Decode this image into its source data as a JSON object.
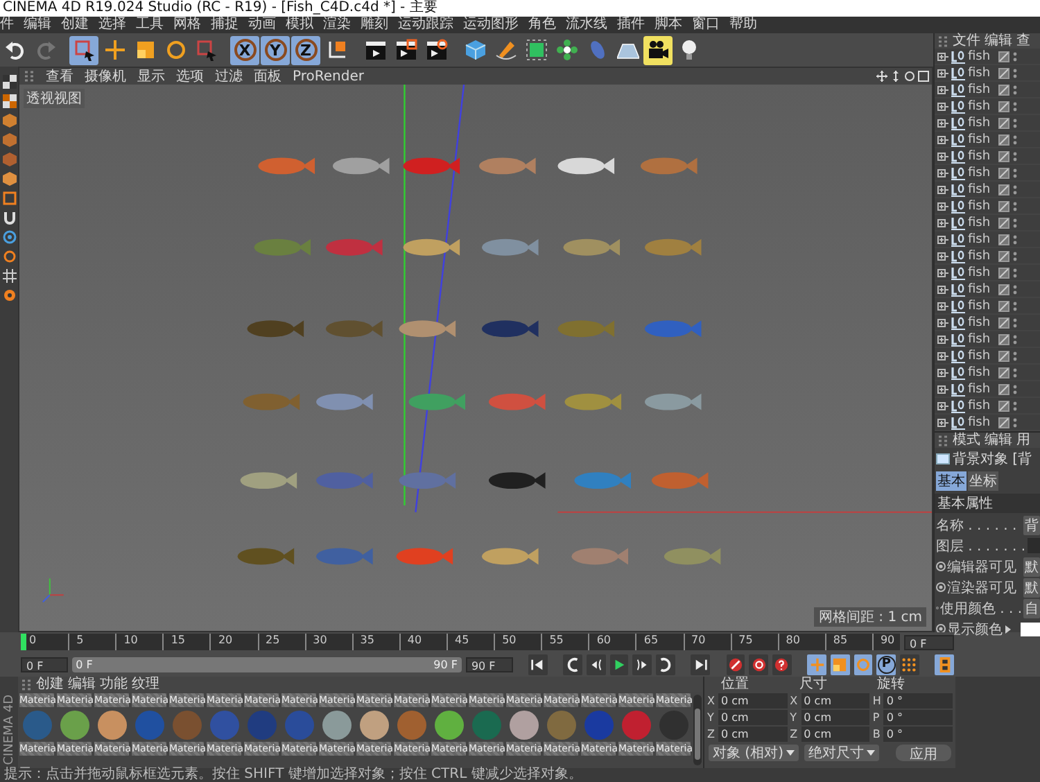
{
  "window": {
    "title": "CINEMA 4D R19.024 Studio (RC - R19) - [Fish_C4D.c4d *] - 主要"
  },
  "menu": [
    "件",
    "编辑",
    "创建",
    "选择",
    "工具",
    "网格",
    "捕捉",
    "动画",
    "模拟",
    "渲染",
    "雕刻",
    "运动跟踪",
    "运动图形",
    "角色",
    "流水线",
    "插件",
    "脚本",
    "窗口",
    "帮助"
  ],
  "toolbar": [
    {
      "kind": "undo",
      "selected": false,
      "disabled": false
    },
    {
      "kind": "redo",
      "selected": false,
      "disabled": true
    },
    {
      "kind": "select",
      "selected": true,
      "disabled": false
    },
    {
      "kind": "move",
      "selected": false,
      "disabled": false
    },
    {
      "kind": "scale",
      "selected": false,
      "disabled": false
    },
    {
      "kind": "rotate",
      "selected": false,
      "disabled": false
    },
    {
      "kind": "box_select",
      "selected": false,
      "disabled": false
    },
    {
      "kind": "axis",
      "label": "X",
      "selected": true,
      "disabled": false
    },
    {
      "kind": "axis",
      "label": "Y",
      "selected": true,
      "disabled": false
    },
    {
      "kind": "axis",
      "label": "Z",
      "selected": true,
      "disabled": false
    },
    {
      "kind": "coord",
      "selected": false,
      "disabled": false
    },
    {
      "kind": "render_view",
      "selected": false,
      "disabled": false
    },
    {
      "kind": "render_pic",
      "selected": false,
      "disabled": false
    },
    {
      "kind": "render_settings",
      "selected": false,
      "disabled": false
    },
    {
      "kind": "cube",
      "selected": false,
      "disabled": false
    },
    {
      "kind": "pen",
      "selected": false,
      "disabled": false
    },
    {
      "kind": "subdiv",
      "selected": false,
      "disabled": false
    },
    {
      "kind": "array",
      "selected": false,
      "disabled": false
    },
    {
      "kind": "deformer",
      "selected": false,
      "disabled": false
    },
    {
      "kind": "floor",
      "selected": false,
      "disabled": false
    },
    {
      "kind": "camera",
      "selected": false,
      "disabled": false
    },
    {
      "kind": "light",
      "selected": false,
      "disabled": false
    }
  ],
  "viewport": {
    "menu": [
      "查看",
      "摄像机",
      "显示",
      "选项",
      "过滤",
      "面板",
      "ProRender"
    ],
    "view_name": "透视视图",
    "grid_spacing": "网格间距 : 1 cm"
  },
  "object_manager": {
    "menu": [
      "文件",
      "编辑",
      "查"
    ],
    "objects": [
      {
        "name": "fish"
      },
      {
        "name": "fish"
      },
      {
        "name": "fish"
      },
      {
        "name": "fish"
      },
      {
        "name": "fish"
      },
      {
        "name": "fish"
      },
      {
        "name": "fish"
      },
      {
        "name": "fish"
      },
      {
        "name": "fish"
      },
      {
        "name": "fish"
      },
      {
        "name": "fish"
      },
      {
        "name": "fish"
      },
      {
        "name": "fish"
      },
      {
        "name": "fish"
      },
      {
        "name": "fish"
      },
      {
        "name": "fish"
      },
      {
        "name": "fish"
      },
      {
        "name": "fish"
      },
      {
        "name": "fish"
      },
      {
        "name": "fish"
      },
      {
        "name": "fish"
      },
      {
        "name": "fish"
      },
      {
        "name": "fish"
      }
    ]
  },
  "attributes": {
    "menu": [
      "模式",
      "编辑",
      "用"
    ],
    "object_title": "背景对象 [背",
    "tabs": [
      {
        "label": "基本",
        "selected": true
      },
      {
        "label": "坐标",
        "selected": false
      }
    ],
    "section": "基本属性",
    "rows": [
      {
        "kind": "field",
        "label": "名称 . . . . . .",
        "value": "背"
      },
      {
        "kind": "field",
        "label": "图层 . . . . . . ."
      },
      {
        "kind": "dropdown",
        "label": "编辑器可见",
        "value": "默"
      },
      {
        "kind": "dropdown",
        "label": "渲染器可见",
        "value": "默"
      },
      {
        "kind": "dropdown",
        "label": "使用颜色 . . .",
        "value": "自"
      },
      {
        "kind": "color",
        "label": "显示颜色",
        "color": "#ffffff"
      }
    ]
  },
  "timeline": {
    "ticks": [
      "0",
      "5",
      "10",
      "15",
      "20",
      "25",
      "30",
      "35",
      "40",
      "45",
      "50",
      "55",
      "60",
      "65",
      "70",
      "75",
      "80",
      "85",
      "90"
    ],
    "level": 0,
    "current_frame": "0 F",
    "start": "0 F",
    "range": {
      "start": "0 F",
      "end": "90 F",
      "level": 1
    },
    "end": "90 F",
    "parameter_key_label": "P"
  },
  "materials": {
    "menu": [
      "创建",
      "编辑",
      "功能",
      "纹理"
    ],
    "row_above": [
      "Materia",
      "Materia",
      "Materia",
      "Materia",
      "Materia",
      "Materia",
      "Materia",
      "Materia",
      "Materia",
      "Materia",
      "Materia",
      "Materia",
      "Materia",
      "Materia",
      "Materia",
      "Materia",
      "Materia",
      "Materia"
    ],
    "items": [
      {
        "label": "Materia",
        "color": "#2a5a8a"
      },
      {
        "label": "Materia",
        "color": "#6aa04a"
      },
      {
        "label": "Materia",
        "color": "#c89060"
      },
      {
        "label": "Materia",
        "color": "#2050a0"
      },
      {
        "label": "Materia",
        "color": "#7a5030"
      },
      {
        "label": "Materia",
        "color": "#3050a0"
      },
      {
        "label": "Materia",
        "color": "#203c80"
      },
      {
        "label": "Materia",
        "color": "#2a4c9a"
      },
      {
        "label": "Materia",
        "color": "#8a9a9a"
      },
      {
        "label": "Materia",
        "color": "#c0a080"
      },
      {
        "label": "Materia",
        "color": "#a06030"
      },
      {
        "label": "Materia",
        "color": "#60b040"
      },
      {
        "label": "Materia",
        "color": "#1a6a50"
      },
      {
        "label": "Materia",
        "color": "#b0a0a0"
      },
      {
        "label": "Materia",
        "color": "#806a40"
      },
      {
        "label": "Materia",
        "color": "#1a3aa0"
      },
      {
        "label": "Materia",
        "color": "#c02030"
      },
      {
        "label": "Materia",
        "color": "#303030"
      }
    ]
  },
  "coordinates": {
    "headers": [
      "位置",
      "尺寸",
      "旋转"
    ],
    "rows": [
      {
        "cells": [
          {
            "axis": "X",
            "value": "0 cm"
          },
          {
            "axis": "X",
            "value": "0 cm"
          },
          {
            "axis": "H",
            "value": "0 °"
          }
        ]
      },
      {
        "cells": [
          {
            "axis": "Y",
            "value": "0 cm"
          },
          {
            "axis": "Y",
            "value": "0 cm"
          },
          {
            "axis": "P",
            "value": "0 °"
          }
        ]
      },
      {
        "cells": [
          {
            "axis": "Z",
            "value": "0 cm"
          },
          {
            "axis": "Z",
            "value": "0 cm"
          },
          {
            "axis": "B",
            "value": "0 °"
          }
        ]
      }
    ],
    "dropdowns": [
      "对象 (相对)",
      "绝对尺寸"
    ],
    "apply_button": "应用"
  },
  "logo": "CINEMA 4D",
  "status_bar": {
    "hint": "提示：点击并拖动鼠标框选元素。按住 SHIFT 键增加选择对象；按住 CTRL 键减少选择对象。"
  }
}
